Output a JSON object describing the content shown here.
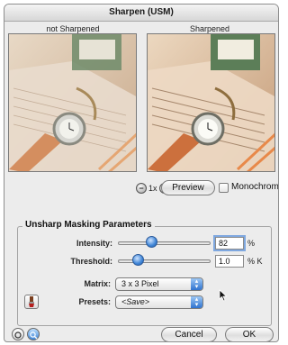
{
  "window": {
    "title": "Sharpen (USM)"
  },
  "previews": {
    "left_caption": "not Sharpened",
    "right_caption": "Sharpened"
  },
  "zoom": {
    "level": "1x",
    "minus_icon": "zoom-out-icon",
    "plus_icon": "zoom-in-icon"
  },
  "preview_button": {
    "label": "Preview"
  },
  "monochrome": {
    "label": "Monochrome",
    "checked": false
  },
  "unsharp": {
    "title": "Unsharp Masking Parameters",
    "intensity": {
      "label": "Intensity:",
      "value": "82",
      "unit": "%",
      "slider_fraction": 0.34
    },
    "threshold": {
      "label": "Threshold:",
      "value": "1.0",
      "unit": "% K",
      "slider_fraction": 0.18
    },
    "matrix": {
      "label": "Matrix:",
      "selected": "3 x 3 Pixel"
    },
    "presets": {
      "label": "Presets:",
      "selected": "<Save>"
    }
  },
  "buttons": {
    "cancel": "Cancel",
    "ok": "OK"
  },
  "icons": {
    "brush_tool": "brush-icon",
    "help": "help-icon",
    "info": "info-icon"
  },
  "colors": {
    "accent": "#3d84d6"
  }
}
